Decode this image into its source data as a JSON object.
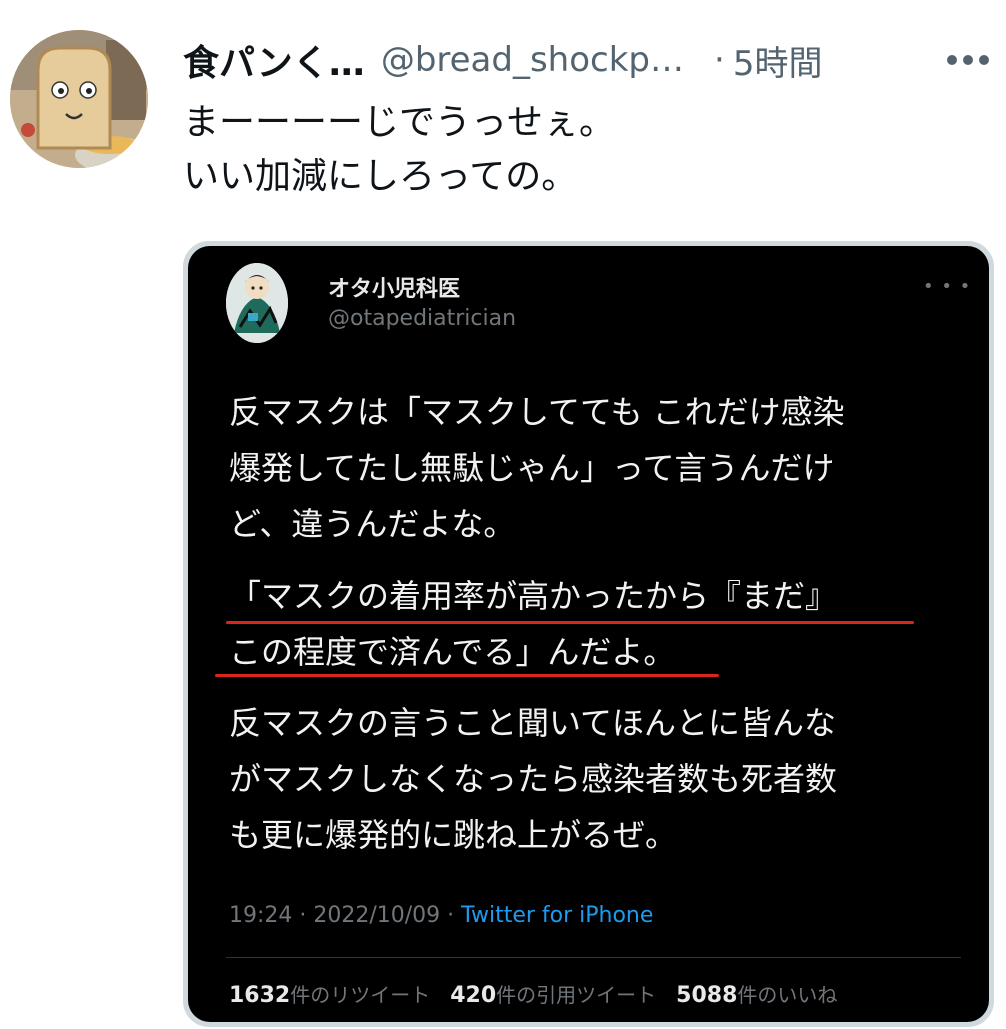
{
  "author": {
    "name": "食パンく…",
    "handle": "@bread_shockp…",
    "separator": "·",
    "time": "5時間"
  },
  "tweet": {
    "lines": [
      "まーーーーじでうっせぇ。",
      "いい加減にしろっての。"
    ]
  },
  "quoted": {
    "name": "オタ小児科医",
    "handle": "@otapediatrician",
    "paragraph1": [
      "反マスクは「マスクしてても これだけ感染",
      "爆発してたし無駄じゃん」って言うんだけ",
      "ど、違うんだよな。"
    ],
    "paragraph2": [
      "「マスクの着用率が高かったから『まだ』",
      "この程度で済んでる」んだよ。"
    ],
    "paragraph3": [
      "反マスクの言うこと聞いてほんとに皆んな",
      "がマスクしなくなったら感染者数も死者数",
      "も更に爆発的に跳ね上がるぜ。"
    ],
    "meta": {
      "time": "19:24 · 2022/10/09 · ",
      "source": "Twitter for iPhone"
    },
    "stats": [
      {
        "count": "1632",
        "label": "件のリツイート"
      },
      {
        "count": "420",
        "label": "件の引用ツイート"
      },
      {
        "count": "5088",
        "label": "件のいいね"
      }
    ]
  },
  "colors": {
    "underline": "#d8261c",
    "link": "#1d9bf0"
  }
}
